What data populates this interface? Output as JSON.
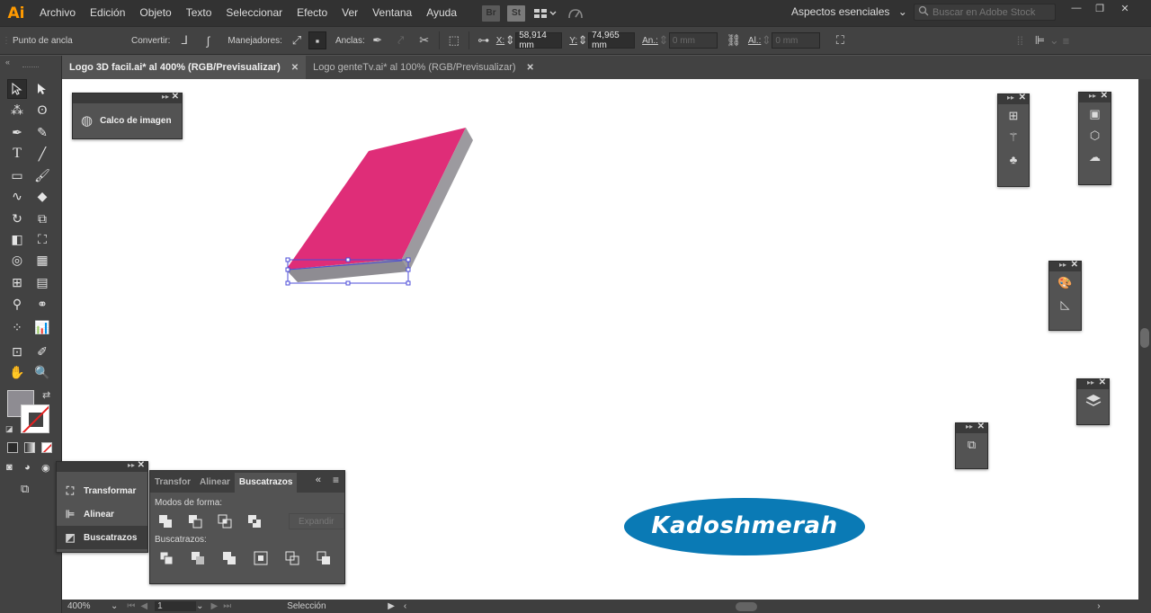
{
  "app": {
    "logo": "Ai",
    "brand_color": "#ff9a00"
  },
  "menu": {
    "items": [
      "Archivo",
      "Edición",
      "Objeto",
      "Texto",
      "Seleccionar",
      "Efecto",
      "Ver",
      "Ventana",
      "Ayuda"
    ],
    "bridge_label": "Br",
    "stock_label": "St",
    "workspace": "Aspectos esenciales",
    "search_placeholder": "Buscar en Adobe Stock"
  },
  "control_bar": {
    "selection_label": "Punto de ancla",
    "convert_label": "Convertir:",
    "handles_label": "Manejadores:",
    "anchors_label": "Anclas:",
    "x_label": "X:",
    "x_value": "58,914 mm",
    "y_label": "Y:",
    "y_value": "74,965 mm",
    "width_label": "An.:",
    "width_value": "0 mm",
    "height_label": "Al.:",
    "height_value": "0 mm"
  },
  "tabs": [
    {
      "label": "Logo 3D facil.ai* al 400% (RGB/Previsualizar)",
      "active": true
    },
    {
      "label": "Logo genteTv.ai* al 100% (RGB/Previsualizar)",
      "active": false
    }
  ],
  "panels": {
    "image_trace": {
      "label": "Calco de imagen"
    },
    "collapsed_list": {
      "items": [
        {
          "label": "Transformar",
          "selected": false
        },
        {
          "label": "Alinear",
          "selected": false
        },
        {
          "label": "Buscatrazos",
          "selected": true
        }
      ]
    },
    "pathfinder": {
      "tabs": [
        "Transfor",
        "Alinear",
        "Buscatrazos"
      ],
      "active_tab": "Buscatrazos",
      "shape_modes_label": "Modos de forma:",
      "expand_label": "Expandir",
      "pathfinders_label": "Buscatrazos:"
    }
  },
  "canvas": {
    "logo_text": "Kadoshmerah",
    "ellipse_color": "#0a7ab5",
    "box_top_color": "#df2d78",
    "box_side_color": "#9c9a9f",
    "box_front_color": "#8e8c92"
  },
  "status": {
    "zoom": "400%",
    "artboard": "1",
    "tool_label": "Selección"
  }
}
